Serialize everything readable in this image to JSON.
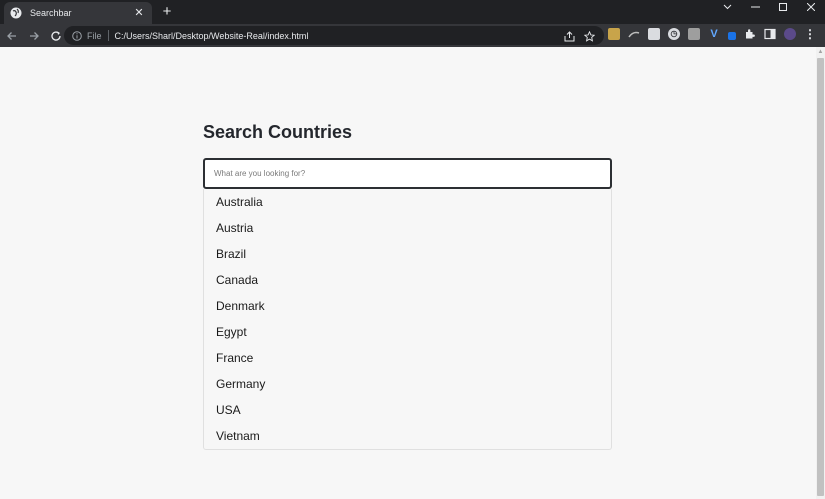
{
  "browser": {
    "tab": {
      "title": "Searchbar"
    },
    "address": {
      "scheme_label": "File",
      "url": "C:/Users/Sharl/Desktop/Website-Real/index.html"
    }
  },
  "page": {
    "heading": "Search Countries",
    "search": {
      "placeholder": "What are you looking for?",
      "value": ""
    },
    "results": [
      "Australia",
      "Austria",
      "Brazil",
      "Canada",
      "Denmark",
      "Egypt",
      "France",
      "Germany",
      "USA",
      "Vietnam"
    ]
  },
  "colors": {
    "tabstrip": "#202124",
    "toolbar": "#35363a",
    "page_background": "#f7f7f7",
    "heading_text": "#24272d",
    "search_border": "#2c2f33"
  },
  "icons": [
    "globe-icon",
    "close-icon",
    "plus-icon",
    "chevron-down-icon",
    "minimize-icon",
    "maximize-icon",
    "back-arrow-icon",
    "forward-arrow-icon",
    "reload-icon",
    "info-icon",
    "share-icon",
    "star-icon",
    "puzzle-icon",
    "sidebar-icon",
    "profile-icon",
    "kebab-menu-icon"
  ]
}
